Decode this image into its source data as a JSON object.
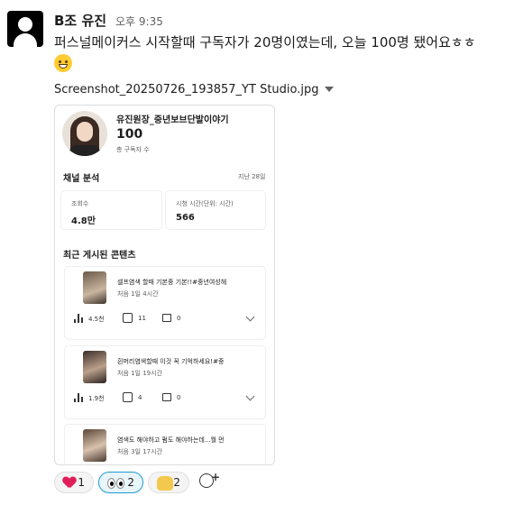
{
  "message": {
    "sender": "B조 유진",
    "time": "오후 9:35",
    "text": "퍼스널메이커스 시작할때 구독자가 20명이였는데, 오늘 100명 됐어요ㅎㅎ",
    "emoji": "grinning-sweat-face"
  },
  "attachment": {
    "filename": "Screenshot_20250726_193857_YT Studio.jpg"
  },
  "screenshot": {
    "channel_name": "유진원장_중년보브단발이야기",
    "subscriber_count": "100",
    "subscriber_label": "총 구독자 수",
    "analysis_title": "채널 분석",
    "analysis_period": "지난 28일",
    "stats": [
      {
        "label": "조회수",
        "value": "4.8만"
      },
      {
        "label": "시청 시간(단위: 시간)",
        "value": "566"
      }
    ],
    "recent_title": "최근 게시된 콘텐츠",
    "videos": [
      {
        "title": "셀프염색 할때 기본중 기본!!#중년여성헤",
        "subtitle": "처음 1일 4시간",
        "views": "4.5천",
        "likes": "11",
        "comments": "0"
      },
      {
        "title": "흰머리염색할때 이것 꼭 기억하세요!#중",
        "subtitle": "처음 1일 19시간",
        "views": "1.9천",
        "likes": "4",
        "comments": "0"
      },
      {
        "title": "염색도 해야하고 펌도 해야하는데...뭘 먼",
        "subtitle": "처음 3일 17시간"
      }
    ]
  },
  "reactions": [
    {
      "emoji": "heart",
      "count": "1"
    },
    {
      "emoji": "eyes",
      "count": "2",
      "active": true
    },
    {
      "emoji": "raised-hands",
      "count": "2"
    }
  ],
  "colors": {
    "accent": "#1d9bd1",
    "heart": "#e01e5a"
  }
}
